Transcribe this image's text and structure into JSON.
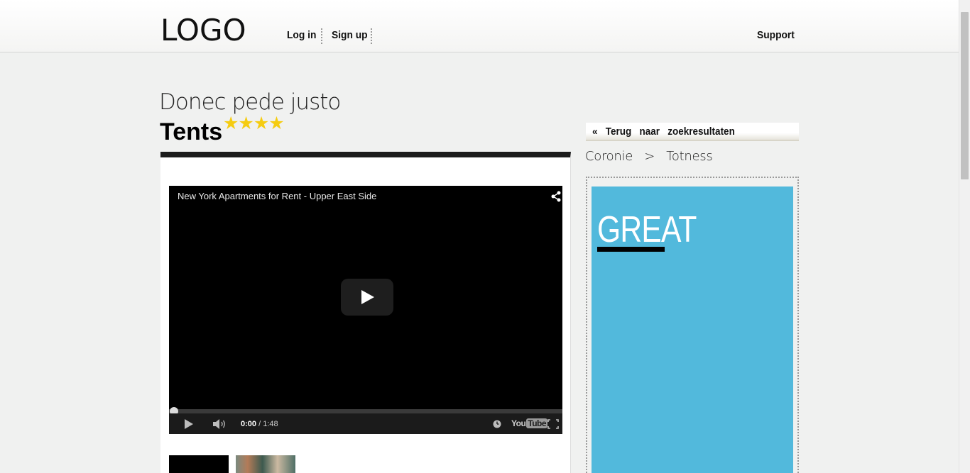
{
  "header": {
    "logo": "LOGO",
    "nav": {
      "login": "Log in",
      "signup": "Sign up",
      "support": "Support"
    }
  },
  "listing": {
    "subtitle": "Donec pede justo",
    "title": "Tents",
    "stars": "★★★★",
    "rating": 4
  },
  "video": {
    "title": "New York Apartments for Rent - Upper East Side",
    "current_time": "0:00",
    "duration": "/ 1:48",
    "brand": "You",
    "brand_tube": "Tube",
    "progress": 0,
    "icons": [
      "share-icon",
      "play-icon",
      "volume-icon",
      "watch-later-icon",
      "fullscreen-icon"
    ]
  },
  "sidebar": {
    "back_link": "«   Terug   naar   zoekresultaten",
    "breadcrumb": "Coronie   >   Totness",
    "ad_text": "GREAT"
  },
  "colors": {
    "star": "#f5cc11",
    "ad_background": "#52b9dc",
    "page_background": "#f0f1f0"
  }
}
